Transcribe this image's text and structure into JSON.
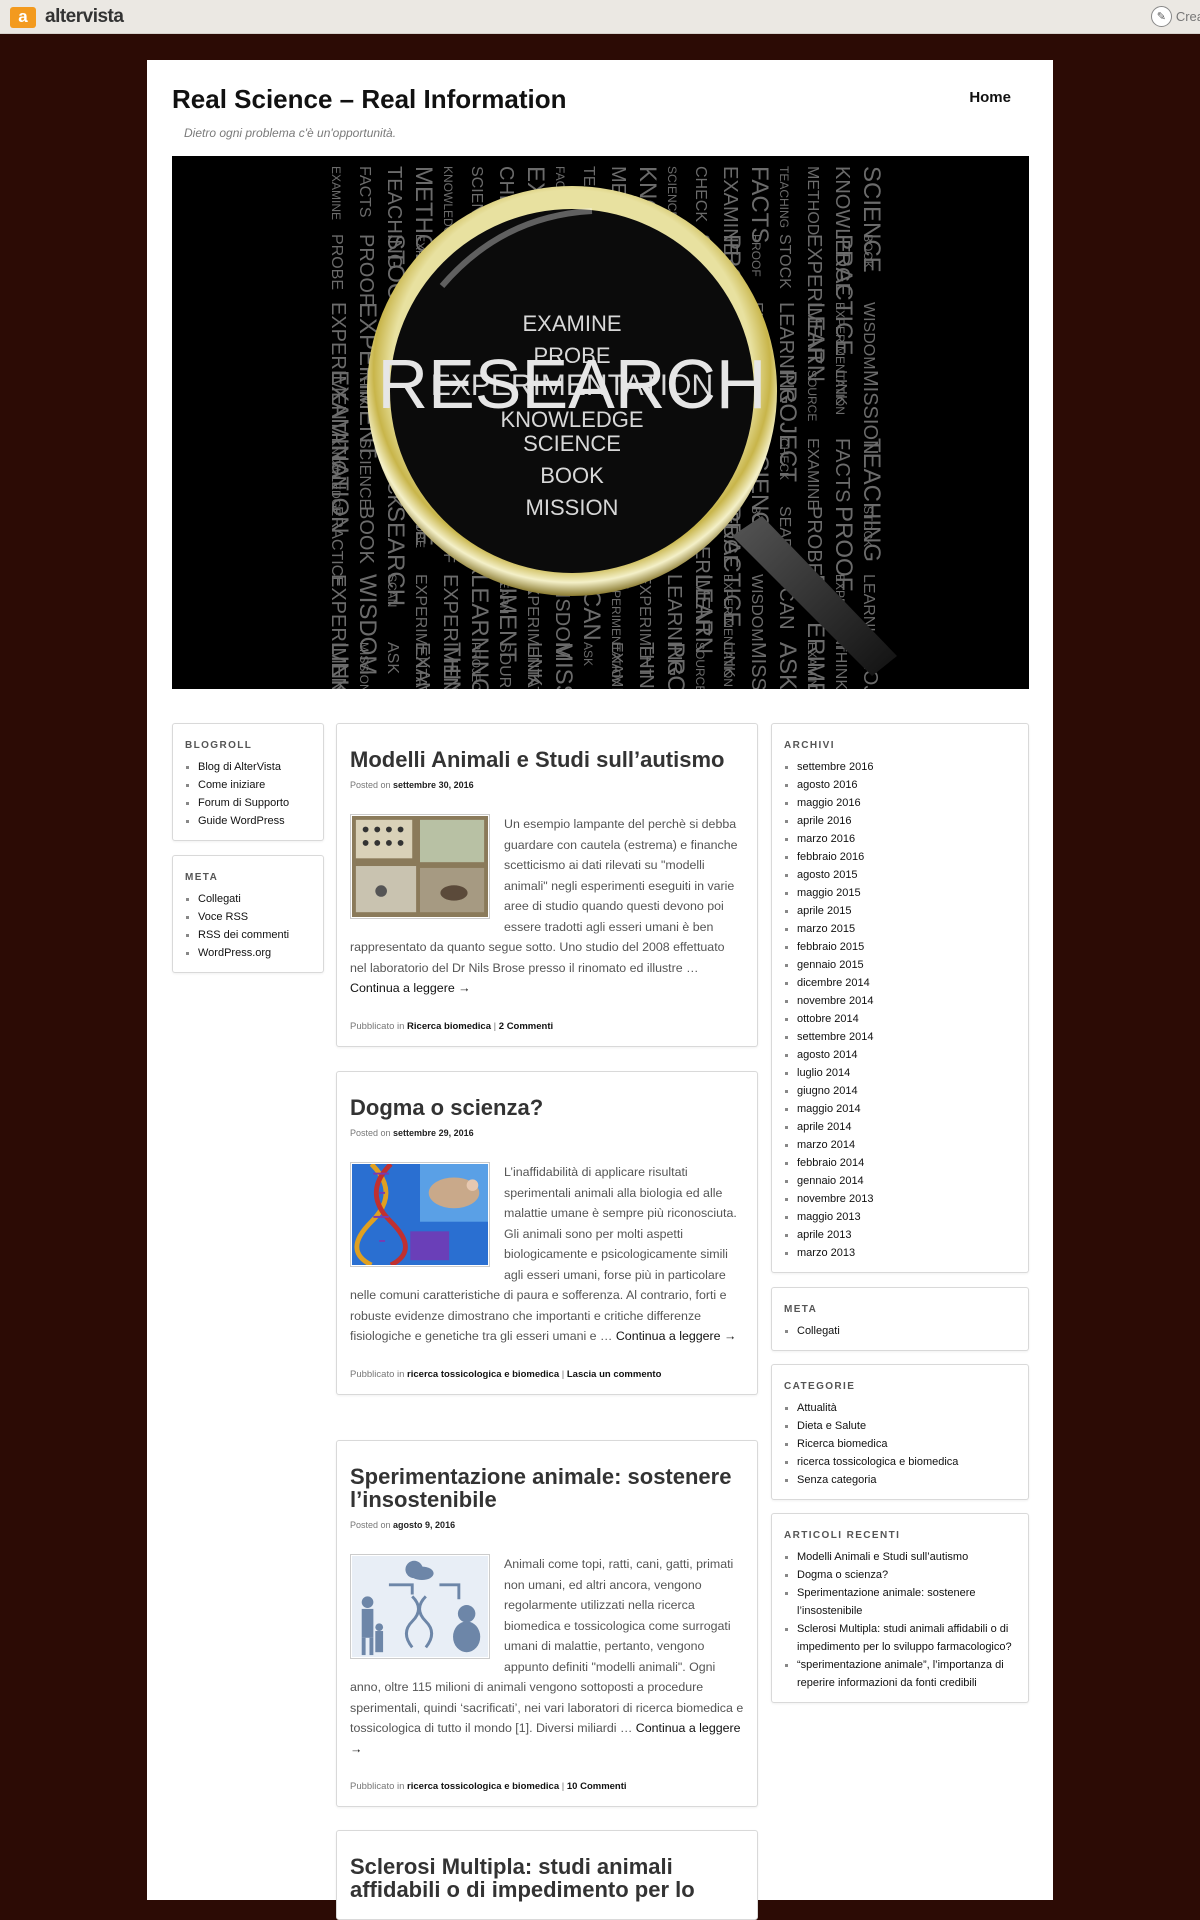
{
  "topbar": {
    "brand_letter": "a",
    "brand": "altervista",
    "create_label": "Crea"
  },
  "site": {
    "title": "Real Science – Real Information",
    "description": "Dietro ogni problema c'è un'opportunità.",
    "nav_home": "Home"
  },
  "banner": {
    "big_word": "RESEARCH",
    "words": [
      "EXAMINE",
      "PROBE",
      "EXPERIMENTATION",
      "EXAMINATION",
      "KNOWLEDGE",
      "PRACTICE",
      "EXPERIMENTATION",
      "LINK",
      "FACTS",
      "PROOF",
      "EXPERIMENT",
      "THINK",
      "SCIENCE",
      "BOOK",
      "WISDOM",
      "MISSION",
      "TEACHING",
      "STOCK",
      "LEARNING",
      "PROJECT",
      "CHECK",
      "SEARCH",
      "SCAN",
      "ASK",
      "METHOD",
      "EXPERIMENT",
      "LEARN",
      "SOURCE"
    ]
  },
  "sidebar_left": {
    "blogroll": {
      "title": "BLOGROLL",
      "items": [
        "Blog di AlterVista",
        "Come iniziare",
        "Forum di Supporto",
        "Guide WordPress"
      ]
    },
    "meta": {
      "title": "META",
      "items": [
        "Collegati",
        "Voce RSS",
        "RSS dei commenti",
        "WordPress.org"
      ]
    }
  },
  "sidebar_right": {
    "archivi": {
      "title": "ARCHIVI",
      "items": [
        "settembre 2016",
        "agosto 2016",
        "maggio 2016",
        "aprile 2016",
        "marzo 2016",
        "febbraio 2016",
        "agosto 2015",
        "maggio 2015",
        "aprile 2015",
        "marzo 2015",
        "febbraio 2015",
        "gennaio 2015",
        "dicembre 2014",
        "novembre 2014",
        "ottobre 2014",
        "settembre 2014",
        "agosto 2014",
        "luglio 2014",
        "giugno 2014",
        "maggio 2014",
        "aprile 2014",
        "marzo 2014",
        "febbraio 2014",
        "gennaio 2014",
        "novembre 2013",
        "maggio 2013",
        "aprile 2013",
        "marzo 2013"
      ]
    },
    "meta": {
      "title": "META",
      "items": [
        "Collegati"
      ]
    },
    "categorie": {
      "title": "CATEGORIE",
      "items": [
        "Attualità",
        "Dieta e Salute",
        "Ricerca biomedica",
        "ricerca tossicologica e biomedica",
        "Senza categoria"
      ]
    },
    "recenti": {
      "title": "ARTICOLI RECENTI",
      "items": [
        "Modelli Animali e Studi sull’autismo",
        "Dogma o scienza?",
        "Sperimentazione animale: sostenere l’insostenibile",
        "Sclerosi Multipla: studi animali affidabili o di impedimento per lo sviluppo farmacologico?",
        "“sperimentazione animale”, l’importanza di reperire informazioni da fonti credibili"
      ]
    }
  },
  "posts": [
    {
      "title": "Modelli Animali e Studi sull’autismo",
      "posted_on": "Posted on",
      "date": "settembre 30, 2016",
      "excerpt": "Un esempio lampante del perchè si debba guardare con cautela (estrema) e finanche scetticismo ai dati rilevati su \"modelli animali\" negli esperimenti eseguiti in varie aree di studio quando questi devono poi essere tradotti agli esseri umani è ben rappresentato da quanto segue sotto. Uno studio del 2008 effettuato nel laboratorio del Dr Nils Brose presso il rinomato ed illustre …",
      "more": "Continua a leggere →",
      "published_in": "Pubblicato in",
      "category": "Ricerca biomedica",
      "sep": "|",
      "comments": "2 Commenti"
    },
    {
      "title": "Dogma o scienza?",
      "posted_on": "Posted on",
      "date": "settembre 29, 2016",
      "excerpt": "L’inaffidabilità di applicare risultati sperimentali animali alla biologia ed alle malattie umane è sempre più riconosciuta. Gli animali sono per molti aspetti biologicamente e psicologicamente simili agli esseri umani, forse più in particolare nelle comuni caratteristiche di paura e sofferenza. Al contrario, forti e robuste evidenze dimostrano che importanti e critiche differenze fisiologiche e genetiche tra gli esseri umani e …",
      "more": "Continua a leggere →",
      "published_in": "Pubblicato in",
      "category": "ricerca tossicologica e biomedica",
      "sep": "|",
      "comments": "Lascia un commento"
    },
    {
      "title": "Sperimentazione animale: sostenere l’insostenibile",
      "posted_on": "Posted on",
      "date": "agosto 9, 2016",
      "excerpt": "Animali come topi, ratti, cani, gatti, primati non umani, ed altri ancora, vengono regolarmente utilizzati nella ricerca biomedica e tossicologica come surrogati umani di malattie, pertanto, vengono appunto definiti \"modelli animali\". Ogni anno, oltre 115 milioni di animali vengono sottoposti a procedure sperimentali,  quindi ‘sacrificati’,  nei vari laboratori di ricerca biomedica e tossicologica di tutto il mondo [1]. Diversi miliardi …",
      "more": "Continua a leggere →",
      "published_in": "Pubblicato in",
      "category": "ricerca tossicologica e biomedica",
      "sep": "|",
      "comments": "10 Commenti"
    },
    {
      "title": "Sclerosi Multipla: studi animali affidabili o di impedimento per lo"
    }
  ]
}
